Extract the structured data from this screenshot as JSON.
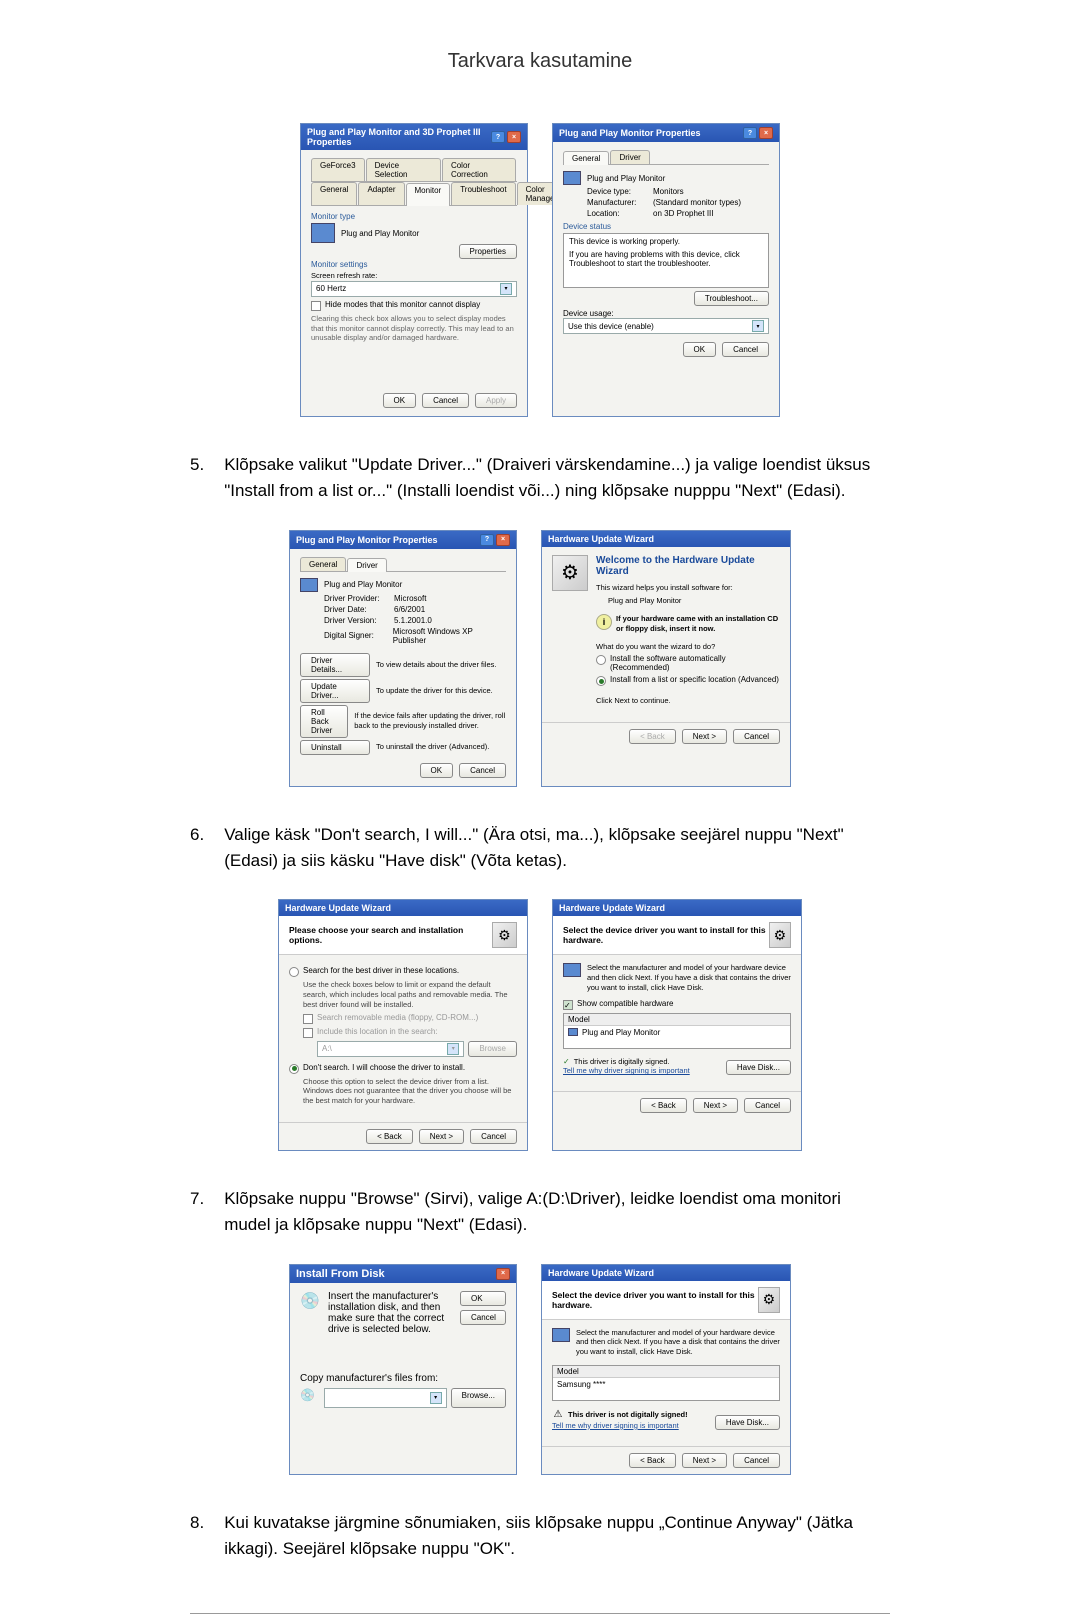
{
  "page_title": "Tarkvara kasutamine",
  "step5": {
    "num": "5.",
    "text": "Klõpsake valikut \"Update Driver...\" (Draiveri värskendamine...) ja valige loendist üksus \"Install from a list or...\" (Installi loendist või...) ning klõpsake nupppu \"Next\" (Edasi)."
  },
  "step6": {
    "num": "6.",
    "text": "Valige käsk \"Don't search, I will...\" (Ära otsi, ma...), klõpsake seejärel nuppu \"Next\" (Edasi) ja siis käsku \"Have disk\" (Võta ketas)."
  },
  "step7": {
    "num": "7.",
    "text": "Klõpsake nuppu \"Browse\" (Sirvi), valige A:(D:\\Driver), leidke loendist oma monitori mudel ja klõpsake nuppu \"Next\" (Edasi)."
  },
  "step8": {
    "num": "8.",
    "text": "Kui kuvatakse järgmine sõnumiaken, siis klõpsake nuppu „Continue Anyway\" (Jätka ikkagi). Seejärel klõpsake nuppu \"OK\"."
  },
  "dlg1": {
    "title": "Plug and Play Monitor and 3D Prophet III Properties",
    "tabs_row1": [
      "GeForce3",
      "Device Selection",
      "Color Correction"
    ],
    "tabs_row2": [
      "General",
      "Adapter",
      "Monitor",
      "Troubleshoot",
      "Color Management"
    ],
    "monitor_type_label": "Monitor type",
    "monitor_type": "Plug and Play Monitor",
    "properties_btn": "Properties",
    "monitor_settings_label": "Monitor settings",
    "refresh_label": "Screen refresh rate:",
    "refresh_value": "60 Hertz",
    "hide_modes": "Hide modes that this monitor cannot display",
    "hide_note": "Clearing this check box allows you to select display modes that this monitor cannot display correctly. This may lead to an unusable display and/or damaged hardware.",
    "ok": "OK",
    "cancel": "Cancel",
    "apply": "Apply"
  },
  "dlg2": {
    "title": "Plug and Play Monitor Properties",
    "tabs": [
      "General",
      "Driver"
    ],
    "name": "Plug and Play Monitor",
    "device_type_label": "Device type:",
    "device_type": "Monitors",
    "manufacturer_label": "Manufacturer:",
    "manufacturer": "(Standard monitor types)",
    "location_label": "Location:",
    "location": "on 3D Prophet III",
    "device_status_label": "Device status",
    "status_text": "This device is working properly.",
    "trouble_text": "If you are having problems with this device, click Troubleshoot to start the troubleshooter.",
    "troubleshoot_btn": "Troubleshoot...",
    "device_usage_label": "Device usage:",
    "usage_value": "Use this device (enable)",
    "ok": "OK",
    "cancel": "Cancel"
  },
  "dlg3": {
    "title": "Plug and Play Monitor Properties",
    "tabs": [
      "General",
      "Driver"
    ],
    "name": "Plug and Play Monitor",
    "provider_label": "Driver Provider:",
    "provider": "Microsoft",
    "date_label": "Driver Date:",
    "date": "6/6/2001",
    "version_label": "Driver Version:",
    "version": "5.1.2001.0",
    "signer_label": "Digital Signer:",
    "signer": "Microsoft Windows XP Publisher",
    "details_btn": "Driver Details...",
    "details_desc": "To view details about the driver files.",
    "update_btn": "Update Driver...",
    "update_desc": "To update the driver for this device.",
    "rollback_btn": "Roll Back Driver",
    "rollback_desc": "If the device fails after updating the driver, roll back to the previously installed driver.",
    "uninstall_btn": "Uninstall",
    "uninstall_desc": "To uninstall the driver (Advanced).",
    "ok": "OK",
    "cancel": "Cancel"
  },
  "dlg4": {
    "title": "Hardware Update Wizard",
    "welcome": "Welcome to the Hardware Update Wizard",
    "help_text": "This wizard helps you install software for:",
    "device": "Plug and Play Monitor",
    "cd_note": "If your hardware came with an installation CD or floppy disk, insert it now.",
    "question": "What do you want the wizard to do?",
    "opt1": "Install the software automatically (Recommended)",
    "opt2": "Install from a list or specific location (Advanced)",
    "continue_text": "Click Next to continue.",
    "back": "< Back",
    "next": "Next >",
    "cancel": "Cancel"
  },
  "dlg5": {
    "title": "Hardware Update Wizard",
    "heading": "Please choose your search and installation options.",
    "opt1": "Search for the best driver in these locations.",
    "opt1_desc": "Use the check boxes below to limit or expand the default search, which includes local paths and removable media. The best driver found will be installed.",
    "chk1": "Search removable media (floppy, CD-ROM...)",
    "chk2": "Include this location in the search:",
    "location": "A:\\",
    "browse": "Browse",
    "opt2": "Don't search. I will choose the driver to install.",
    "opt2_desc": "Choose this option to select the device driver from a list. Windows does not guarantee that the driver you choose will be the best match for your hardware.",
    "back": "< Back",
    "next": "Next >",
    "cancel": "Cancel"
  },
  "dlg6": {
    "title": "Hardware Update Wizard",
    "heading": "Select the device driver you want to install for this hardware.",
    "desc": "Select the manufacturer and model of your hardware device and then click Next. If you have a disk that contains the driver you want to install, click Have Disk.",
    "compat_chk": "Show compatible hardware",
    "model_label": "Model",
    "model": "Plug and Play Monitor",
    "signed": "This driver is digitally signed.",
    "tell_me": "Tell me why driver signing is important",
    "have_disk": "Have Disk...",
    "back": "< Back",
    "next": "Next >",
    "cancel": "Cancel"
  },
  "dlg7": {
    "title": "Install From Disk",
    "desc": "Insert the manufacturer's installation disk, and then make sure that the correct drive is selected below.",
    "copy_label": "Copy manufacturer's files from:",
    "path": "",
    "ok": "OK",
    "cancel": "Cancel",
    "browse": "Browse..."
  },
  "dlg8": {
    "title": "Hardware Update Wizard",
    "heading": "Select the device driver you want to install for this hardware.",
    "desc": "Select the manufacturer and model of your hardware device and then click Next. If you have a disk that contains the driver you want to install, click Have Disk.",
    "model_label": "Model",
    "model": "Samsung ****",
    "unsigned": "This driver is not digitally signed!",
    "tell_me": "Tell me why driver signing is important",
    "have_disk": "Have Disk...",
    "back": "< Back",
    "next": "Next >",
    "cancel": "Cancel"
  }
}
